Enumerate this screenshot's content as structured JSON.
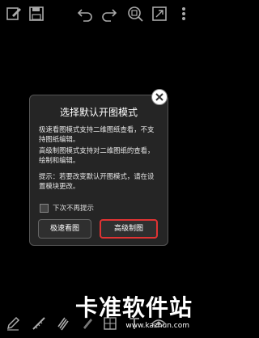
{
  "toolbar": {
    "icons": [
      "edit-icon",
      "save-icon",
      "undo-icon",
      "redo-icon",
      "zoom-fit-icon",
      "fullscreen-icon",
      "more-icon"
    ]
  },
  "dialog": {
    "title": "选择默认开图模式",
    "para1": "极速看图模式支持二维图纸查看，不支持图纸编辑。",
    "para2": "高级制图模式支持对二维图纸的查看，绘制和编辑。",
    "para3": "提示：若要改变默认开图模式，请在设置模块更改。",
    "checkbox_label": "下次不再提示",
    "checkbox_checked": false,
    "btn_fast": "极速看图",
    "btn_advanced": "高级制图",
    "highlight_color": "#e03333"
  },
  "bottombar": {
    "icons": [
      "pencil-icon",
      "measure-icon",
      "layers-icon",
      "pen-icon",
      "grid-icon",
      "text-icon",
      "eye-icon"
    ]
  },
  "watermark": {
    "text": "卡准软件站",
    "url": "www.kazhun.com"
  }
}
